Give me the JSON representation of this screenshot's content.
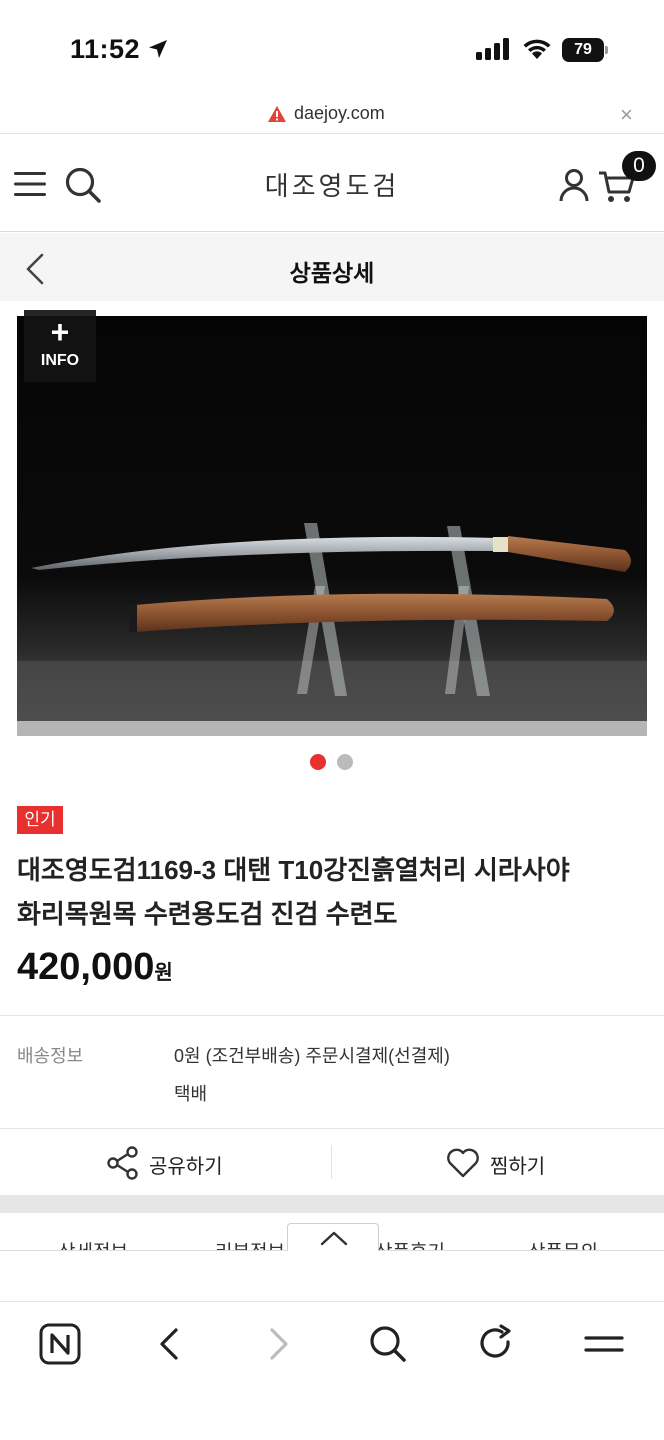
{
  "status_bar": {
    "time": "11:52",
    "battery": "79",
    "icons": [
      "location-arrow-icon",
      "signal-icon",
      "wifi-icon",
      "battery-icon"
    ]
  },
  "browser": {
    "url": "daejoy.com",
    "close_symbol": "×"
  },
  "header": {
    "logo": "대조영도검",
    "cart_count": "0"
  },
  "subheader": {
    "title": "상품상세"
  },
  "product": {
    "info_plus": "+",
    "info_label": "INFO",
    "image_count": 2,
    "active_image": 1,
    "badge": "인기",
    "title_line1": "대조영도검1169-3 대탠 T10강진흙열처리 시라사야",
    "title_line2": "화리목원목 수련용도검 진검 수련도",
    "price": "420,000",
    "price_unit": "원"
  },
  "shipping": {
    "label": "배송정보",
    "value": "0원 (조건부배송) 주문시결제(선결제)",
    "method": "택배"
  },
  "actions": {
    "share_label": "공유하기",
    "wish_label": "찜하기"
  },
  "tabs": [
    "상세정보",
    "리뷰정보",
    "상품후기",
    "상품문의"
  ],
  "colors": {
    "accent_red": "#e8302f",
    "inactive_dot": "#bbbbbb",
    "header_bg": "#f5f5f5"
  }
}
